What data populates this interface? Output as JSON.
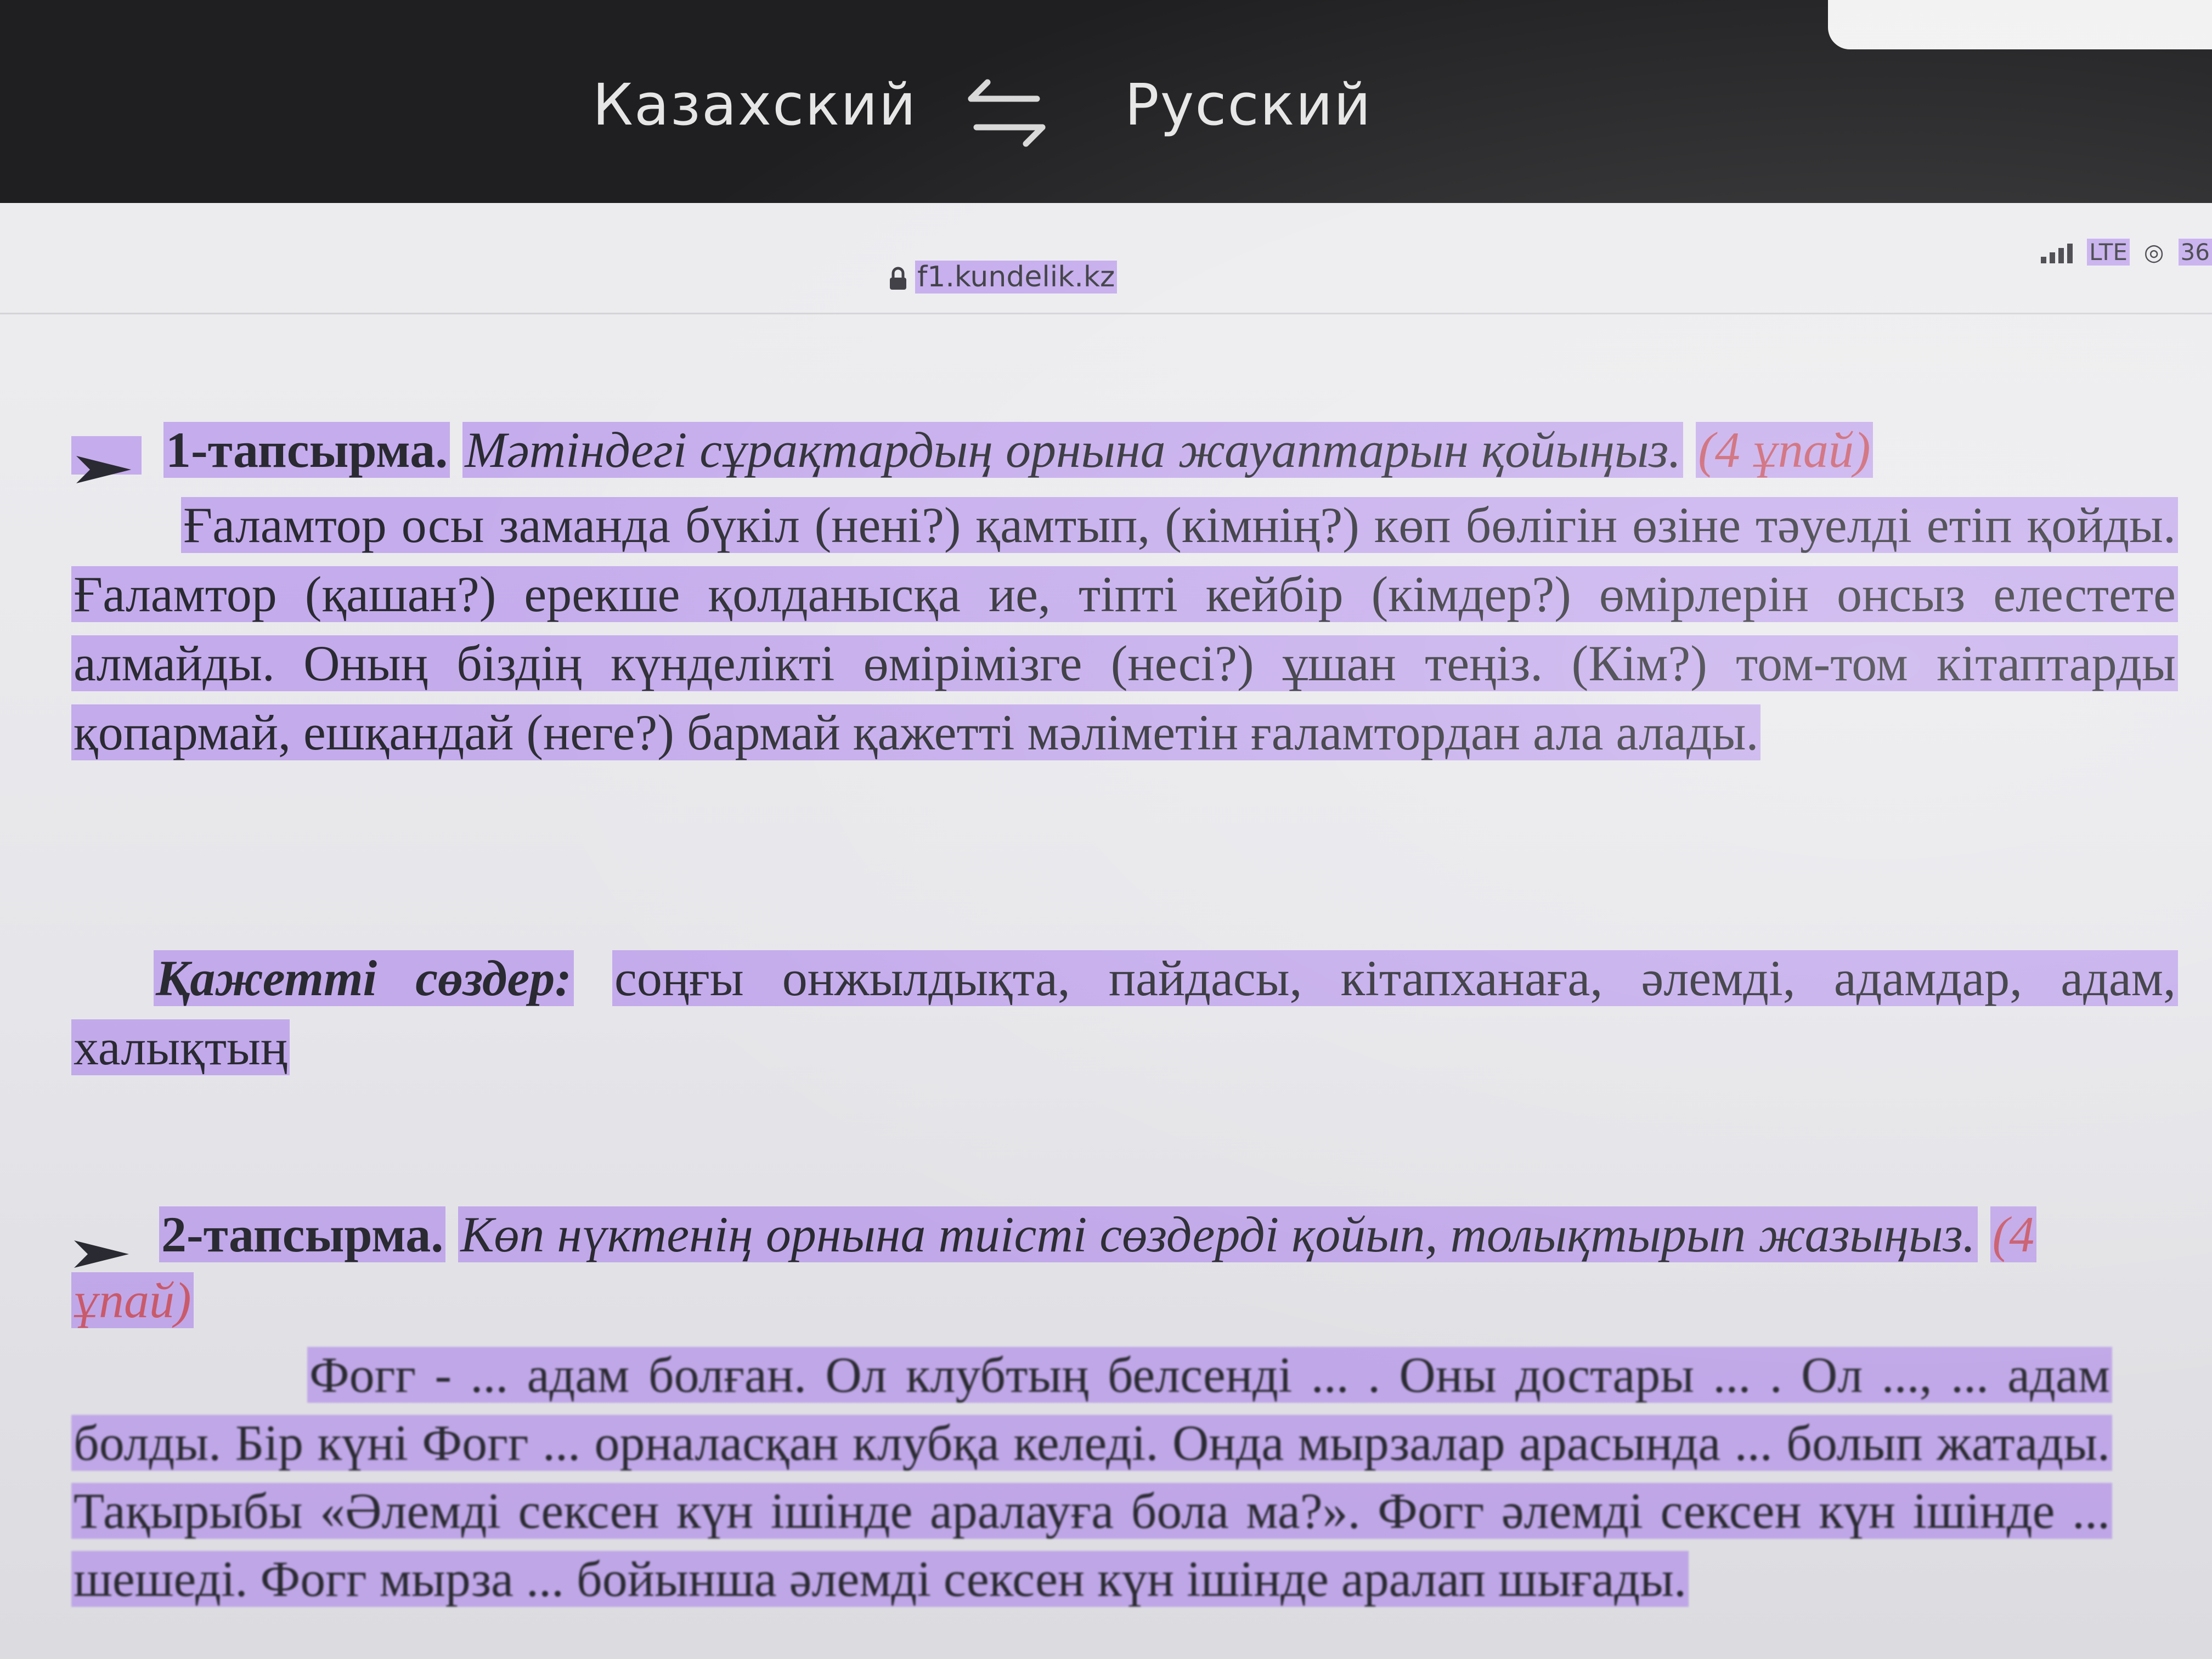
{
  "translator": {
    "source_lang": "Казахский",
    "target_lang": "Русский",
    "swap_icon": "swap-arrows-icon"
  },
  "browser": {
    "lock_icon": "lock-icon",
    "url": "f1.kundelik.kz",
    "network": "LTE",
    "battery_partial": "36"
  },
  "colors": {
    "highlight": "#a678eb",
    "points": "#c95a6a",
    "translator_bar": "#1f1f21"
  },
  "task1": {
    "arrow_icon": "arrowhead-bullet-icon",
    "label": "1-тапсырма.",
    "instruction": "Мәтіндегі сұрақтардың орнына жауаптарын қойыңыз.",
    "points": "(4 ұпай)",
    "text": "Ғаламтор осы заманда бүкіл (нені?) қамтып, (кімнің?) көп бөлігін өзіне тәуелді етіп қойды. Ғаламтор (қашан?) ерекше қолданысқа ие, тіпті кейбір (кімдер?) өмірлерін онсыз елестете алмайды. Оның біздің күнделікті өмірімізге (несі?) ұшан теңіз. (Кім?) том-том кітаптарды қопармай, ешқандай (неге?) бармай қажетті мәліметін ғаламтордан ала алады."
  },
  "vocab": {
    "label": "Қажетті сөздер:",
    "words": "соңғы онжылдықта, пайдасы, кітапханаға, әлемді, адамдар, адам, халықтың"
  },
  "task2": {
    "arrow_icon": "arrowhead-bullet-icon",
    "label": "2-тапсырма.",
    "instruction": "Көп нүктенің орнына тиісті сөздерді қойып, толықтырып жазыңыз.",
    "points": "(4 ұпай)",
    "text": "Фогг - ... адам болған. Ол клубтың белсенді ... . Оны достары ... . Ол ..., ... адам болды. Бір күні Фогг ... орналасқан клубқа келеді. Онда мырзалар арасында ... болып жатады. Тақырыбы «Әлемді сексен күн ішінде аралауға бола ма?». Фогг әлемді сексен күн ішінде ... шешеді. Фогг мырза ... бойынша әлемді сексен күн ішінде аралап шығады."
  }
}
